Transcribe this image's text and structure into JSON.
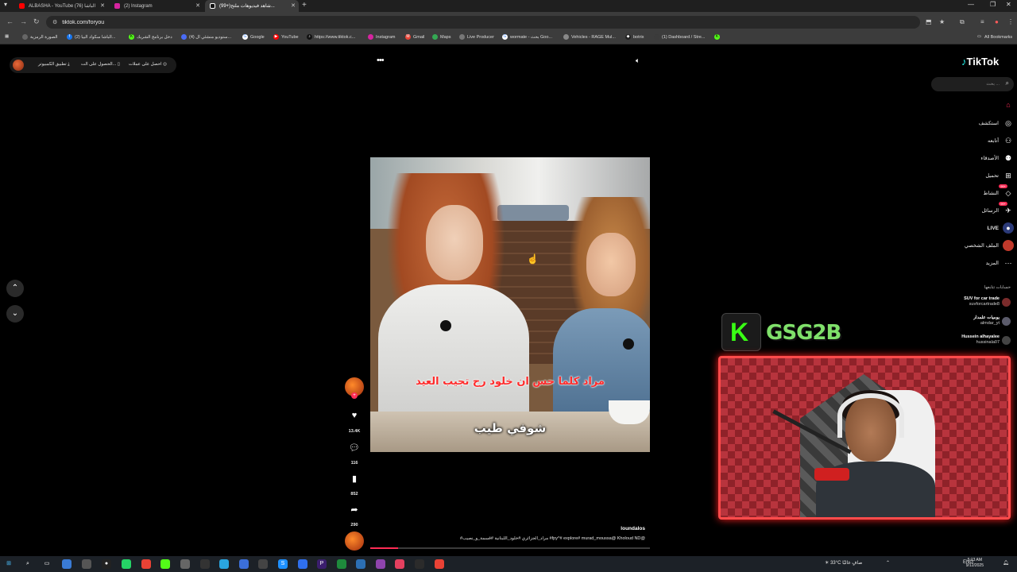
{
  "browser": {
    "tabs": [
      {
        "title": "ALBASHA - YouTube الباشا (76)",
        "color": "#ff0000",
        "icon": "youtube-icon",
        "active": false
      },
      {
        "title": "(2) Instagram",
        "color": "#d6249f",
        "icon": "instagram-icon",
        "active": false
      },
      {
        "title": "(99+)شاهد فيديوهات ملتح...",
        "color": "#ffffff",
        "icon": "tiktok-icon",
        "active": true
      }
    ],
    "url": "tiktok.com/foryou",
    "bookmarks": [
      "الصورة الرمزية",
      "(2) الباشا سكواد البيا...",
      "دخل برنامج الشريك",
      "(4) ستوديو منشئي ال...",
      "Google",
      "YouTube",
      "https://www.tiktok.c...",
      "Instagram",
      "Gmail",
      "Maps",
      "Live Producer",
      "wormate - بحث Goo...",
      "Vehicles - RAGE Mul...",
      "botrix",
      "(1) Dashboard / Stre..."
    ],
    "all_bookmarks": "All Bookmarks"
  },
  "tiktok": {
    "top_buttons": {
      "get_coins": "احصل على عملات",
      "get_on_tv": "الحصول على الت...",
      "desktop_app": "تطبيق الكمبيوتر"
    },
    "logo": "TikTok",
    "search_placeholder": "بحث ...",
    "nav": [
      {
        "label": "",
        "icon": "home-icon",
        "key": "home"
      },
      {
        "label": "استكشف",
        "icon": "compass-icon"
      },
      {
        "label": "أتابعه",
        "icon": "user-check-icon"
      },
      {
        "label": "الأصدقاء",
        "icon": "friends-icon"
      },
      {
        "label": "تحميل",
        "icon": "upload-icon"
      },
      {
        "label": "النشاط",
        "icon": "activity-icon",
        "badge": "99+"
      },
      {
        "label": "الرسائل",
        "icon": "messages-icon",
        "badge": "99+"
      },
      {
        "label": "LIVE",
        "icon": "live-icon"
      },
      {
        "label": "الملف الشخصي",
        "icon": "profile-icon"
      },
      {
        "label": "المزيد",
        "icon": "more-icon"
      }
    ],
    "following_title": "حسابات تتابعها",
    "following": [
      {
        "name": "SUV for car trade",
        "handle": "suvforcartrade8"
      },
      {
        "name": "يوميات علمدار",
        "handle": "almdar_yt"
      },
      {
        "name": "Hussein alhayalee",
        "handle": "hussinala07"
      }
    ],
    "video": {
      "subtitle_red": "مراد كلما حس ان خلود رح تجيب العيد",
      "subtitle_white": "شوفي طيب",
      "author": "loundalos",
      "caption": "#مراد_الجزائري #خلود_اللبنانية #قسمة_و_نصيب #fpy^# explore# murad_moussa@ Kholoud ND@",
      "progress": 0.1
    },
    "actions": {
      "likes": "13.4K",
      "comments": "116",
      "saves": "852",
      "shares": "290"
    }
  },
  "overlay": {
    "channel_name": "GSG2B",
    "logo_letter": "K"
  },
  "taskbar": {
    "weather": "33°C",
    "weather_text": "صافٍ غالبًا",
    "lang": "ENG",
    "time": "5:13 AM",
    "date": "9/12/2025"
  }
}
